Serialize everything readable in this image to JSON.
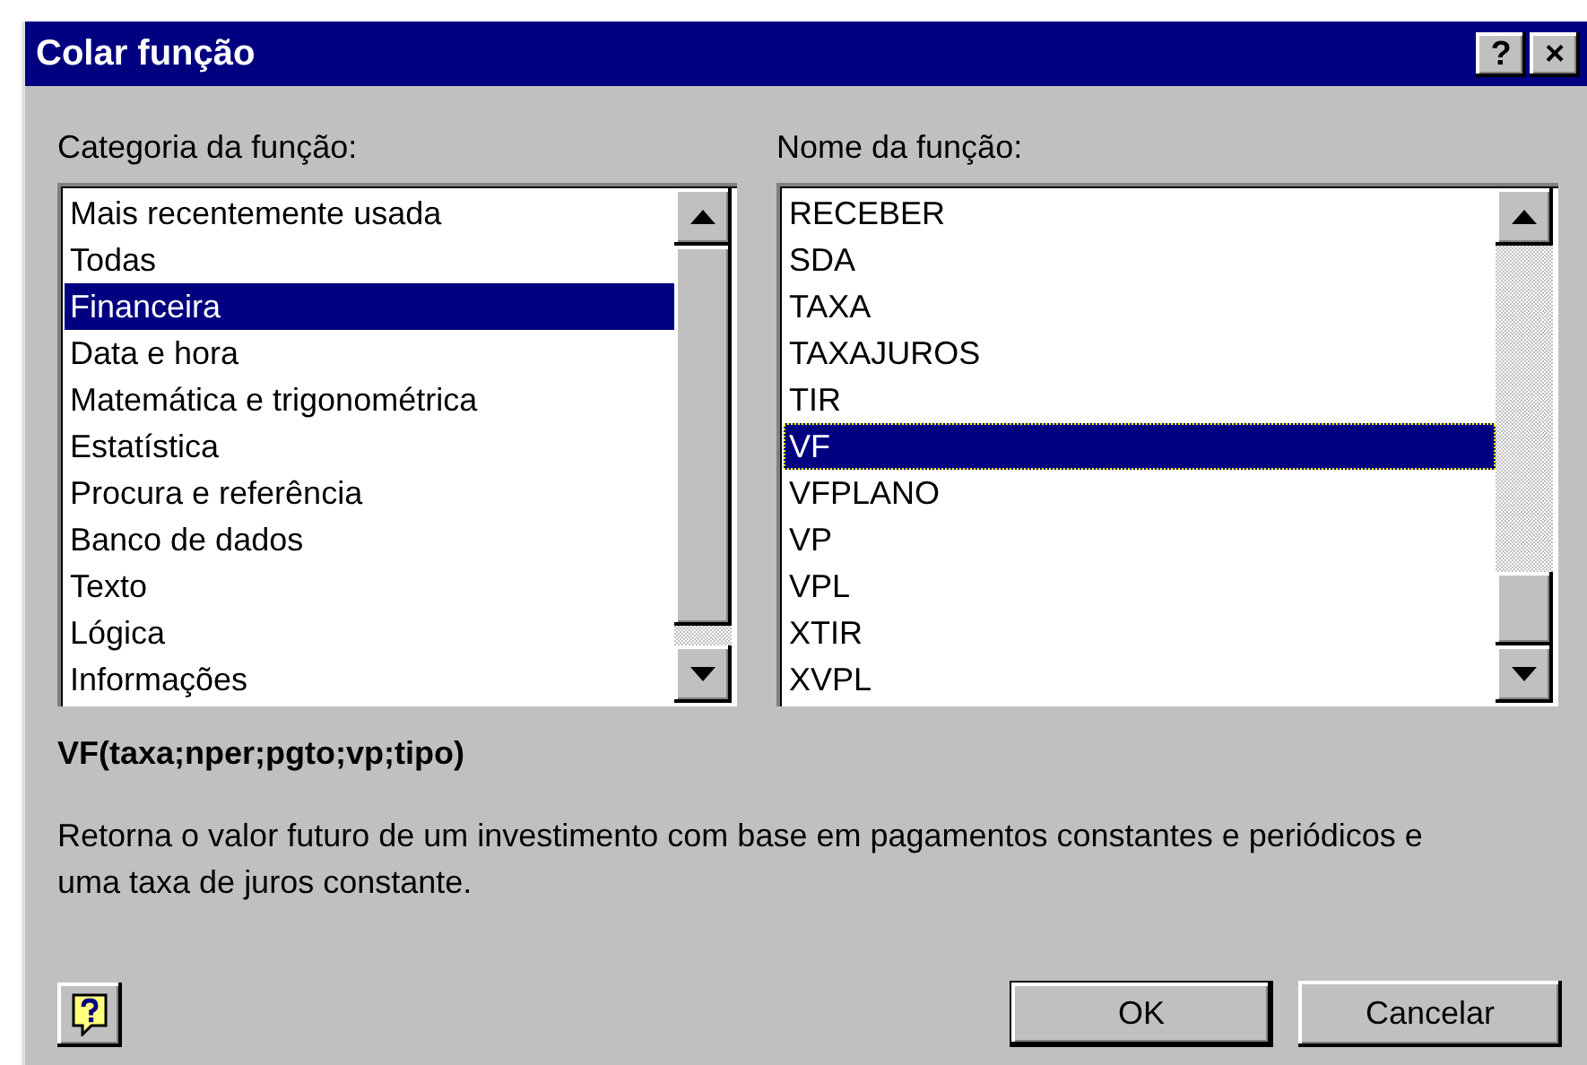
{
  "window": {
    "title": "Colar função",
    "buttons": [
      "?",
      "×"
    ]
  },
  "category_list": {
    "label": "Categoria da função:",
    "items": [
      {
        "label": "Mais recentemente usada",
        "selected": false
      },
      {
        "label": "Todas",
        "selected": false
      },
      {
        "label": "Financeira",
        "selected": true
      },
      {
        "label": "Data e hora",
        "selected": false
      },
      {
        "label": "Matemática e trigonométrica",
        "selected": false
      },
      {
        "label": "Estatística",
        "selected": false
      },
      {
        "label": "Procura e referência",
        "selected": false
      },
      {
        "label": "Banco de dados",
        "selected": false
      },
      {
        "label": "Texto",
        "selected": false
      },
      {
        "label": "Lógica",
        "selected": false
      },
      {
        "label": "Informações",
        "selected": false
      }
    ]
  },
  "function_list": {
    "label": "Nome da função:",
    "items": [
      {
        "label": "RECEBER",
        "selected": false
      },
      {
        "label": "SDA",
        "selected": false
      },
      {
        "label": "TAXA",
        "selected": false
      },
      {
        "label": "TAXAJUROS",
        "selected": false
      },
      {
        "label": "TIR",
        "selected": false
      },
      {
        "label": "VF",
        "selected": true
      },
      {
        "label": "VFPLANO",
        "selected": false
      },
      {
        "label": "VP",
        "selected": false
      },
      {
        "label": "VPL",
        "selected": false
      },
      {
        "label": "XTIR",
        "selected": false
      },
      {
        "label": "XVPL",
        "selected": false
      }
    ]
  },
  "signature": "VF(taxa;nper;pgto;vp;tipo)",
  "description": "Retorna o valor futuro de um investimento com base em pagamentos constantes e periódicos e uma taxa de juros constante.",
  "buttons": [
    "OK",
    "Cancelar"
  ]
}
